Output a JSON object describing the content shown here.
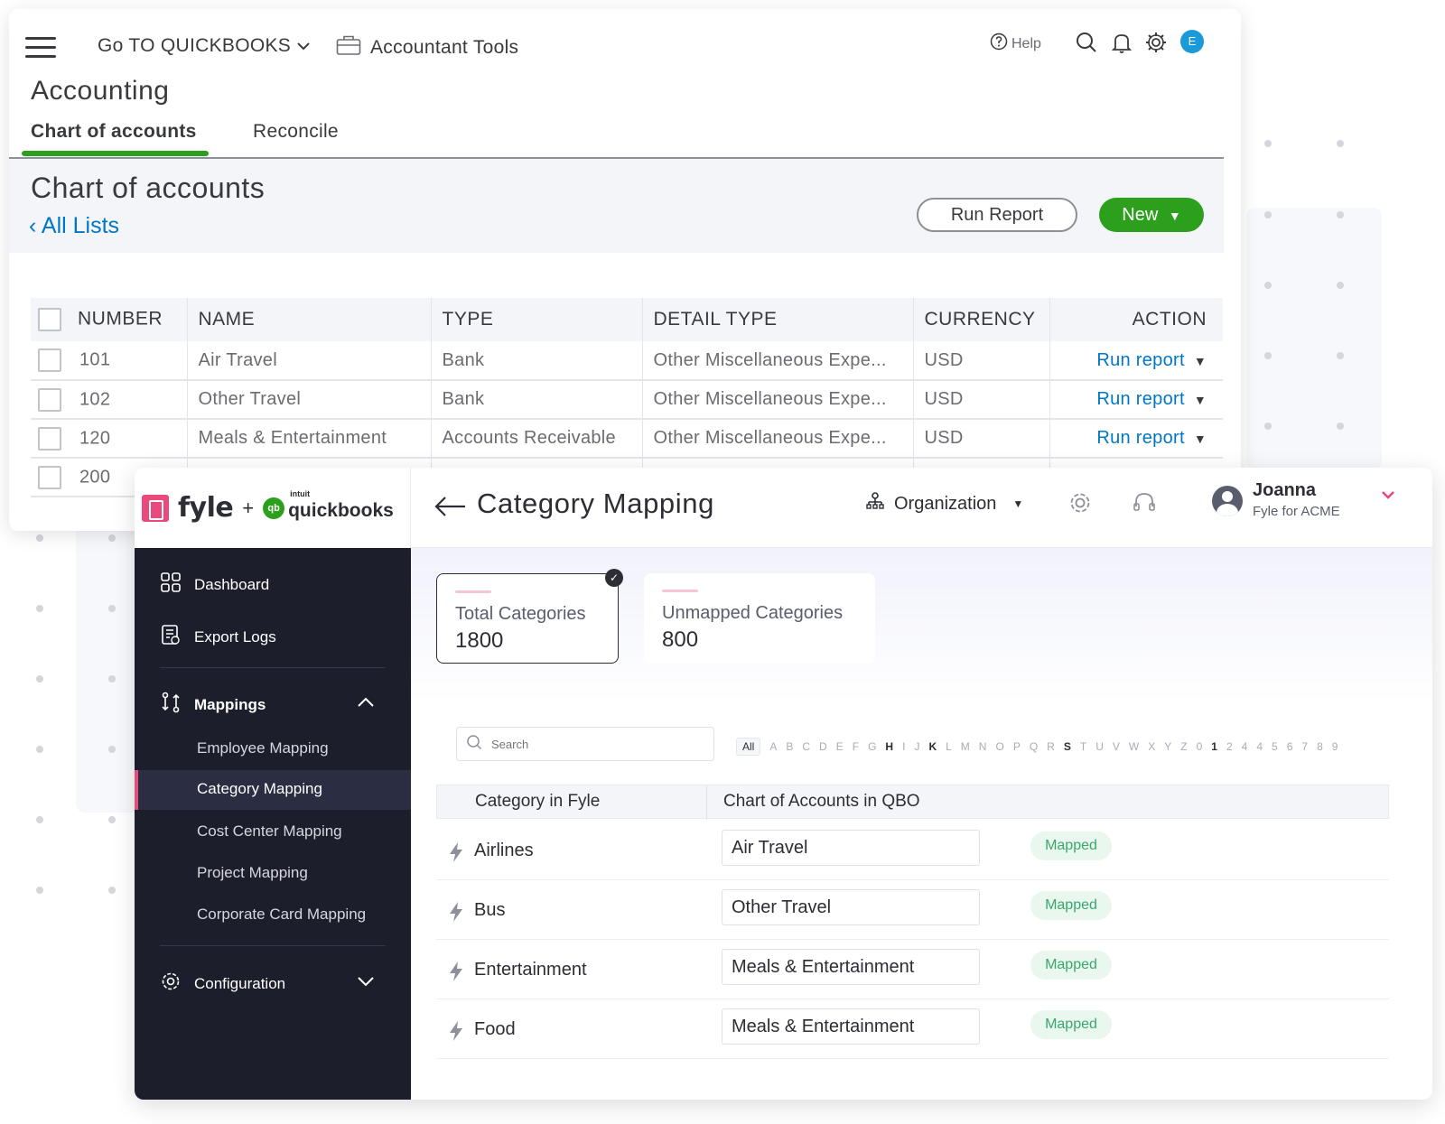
{
  "qb": {
    "goto": "Go TO QUICKBOOKS",
    "accountant_tools": "Accountant Tools",
    "help": "Help",
    "avatar_initial": "E",
    "section": "Accounting",
    "tabs": [
      "Chart of accounts",
      "Reconcile"
    ],
    "page_title": "Chart of accounts",
    "back_link": "All Lists",
    "run_report_button": "Run Report",
    "new_button": "New",
    "table": {
      "headers": [
        "NUMBER",
        "NAME",
        "TYPE",
        "DETAIL TYPE",
        "CURRENCY",
        "ACTION"
      ],
      "rows": [
        {
          "number": "101",
          "name": "Air Travel",
          "type": "Bank",
          "detail": "Other Miscellaneous Expe...",
          "currency": "USD",
          "action": "Run report"
        },
        {
          "number": "102",
          "name": "Other Travel",
          "type": "Bank",
          "detail": "Other Miscellaneous Expe...",
          "currency": "USD",
          "action": "Run report"
        },
        {
          "number": "120",
          "name": "Meals & Entertainment",
          "type": "Accounts Receivable",
          "detail": "Other Miscellaneous Expe...",
          "currency": "USD",
          "action": "Run report"
        },
        {
          "number": "200",
          "name": "",
          "type": "",
          "detail": "",
          "currency": "",
          "action": ""
        }
      ]
    },
    "colors": {
      "green": "#2ca01c",
      "link": "#0077c5",
      "avatar": "#1a9ad9"
    }
  },
  "fyle": {
    "brand": "fyle",
    "plus": "+",
    "qbo_intuit": "intuit",
    "qbo_brand": "quickbooks",
    "qbo_mark": "qb",
    "title": "Category Mapping",
    "org_selector": "Organization",
    "user": {
      "name": "Joanna",
      "org": "Fyle for ACME"
    },
    "sidebar": {
      "dashboard": "Dashboard",
      "export_logs": "Export Logs",
      "mappings": "Mappings",
      "sub_items": [
        "Employee Mapping",
        "Category Mapping",
        "Cost Center Mapping",
        "Project Mapping",
        "Corporate Card Mapping"
      ],
      "active_sub": "Category Mapping",
      "configuration": "Configuration"
    },
    "cards": [
      {
        "label": "Total Categories",
        "value": "1800",
        "selected": true
      },
      {
        "label": "Unmapped Categories",
        "value": "800",
        "selected": false
      }
    ],
    "search_placeholder": "Search",
    "alphabet": [
      "All",
      "A",
      "B",
      "C",
      "D",
      "E",
      "F",
      "G",
      "H",
      "I",
      "J",
      "K",
      "L",
      "M",
      "N",
      "O",
      "P",
      "Q",
      "R",
      "S",
      "T",
      "U",
      "V",
      "W",
      "X",
      "Y",
      "Z",
      "0",
      "1",
      "2",
      "4",
      "4",
      "5",
      "6",
      "7",
      "8",
      "9"
    ],
    "columns": [
      "Category in Fyle",
      "Chart of Accounts in QBO"
    ],
    "mappings": [
      {
        "category": "Airlines",
        "account": "Air Travel",
        "status": "Mapped"
      },
      {
        "category": "Bus",
        "account": "Other Travel",
        "status": "Mapped"
      },
      {
        "category": "Entertainment",
        "account": "Meals & Entertainment",
        "status": "Mapped"
      },
      {
        "category": "Food",
        "account": "Meals & Entertainment",
        "status": "Mapped"
      }
    ],
    "colors": {
      "brand_pink": "#e94a7b",
      "sidebar_bg": "#1d1e2c",
      "mapped_green": "#3aa76d"
    }
  }
}
